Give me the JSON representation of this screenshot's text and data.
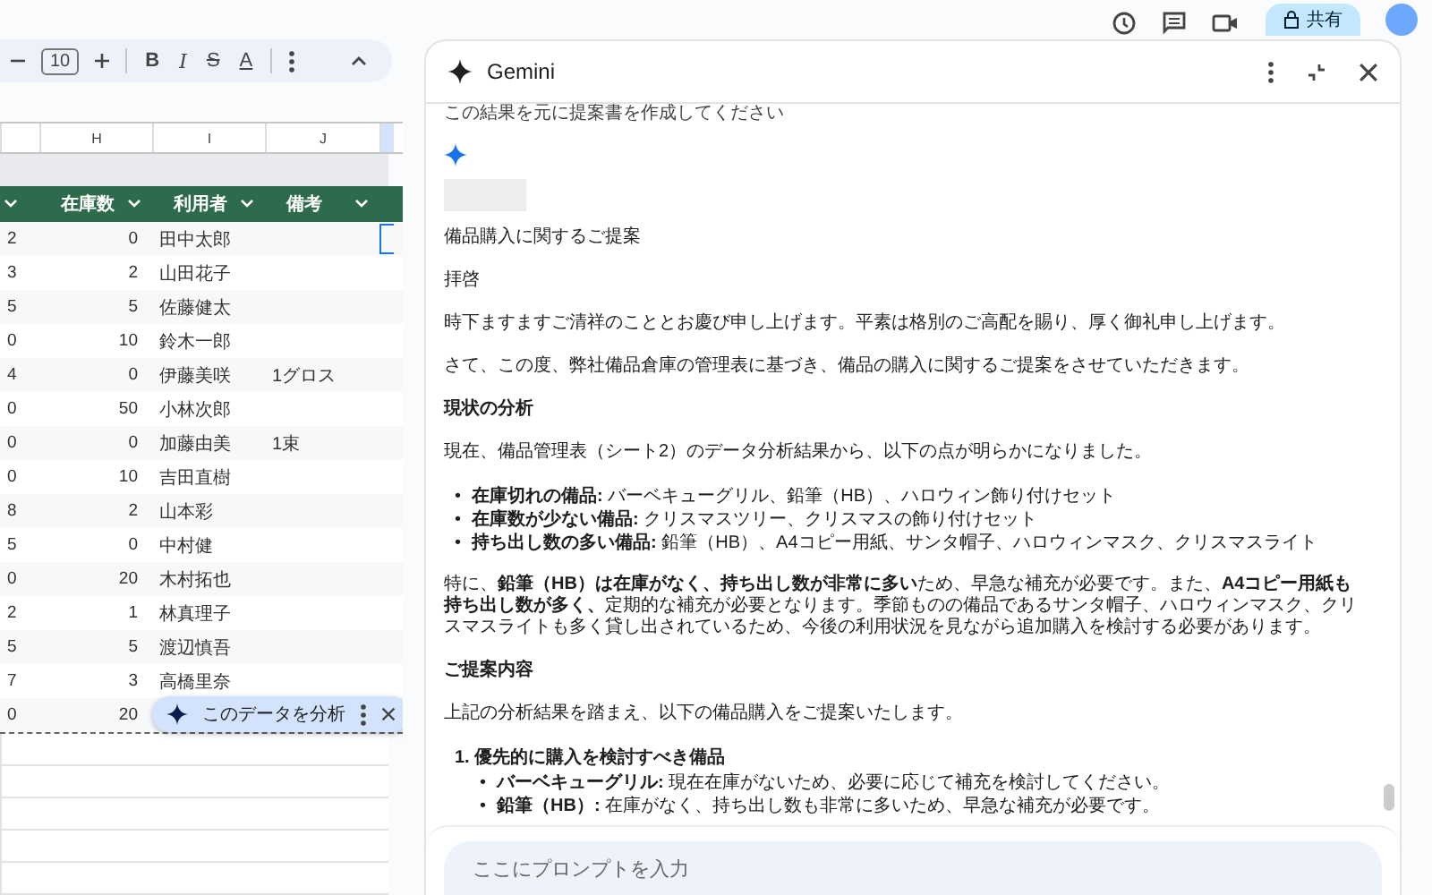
{
  "top_bar": {
    "share_label": "共有"
  },
  "toolbar": {
    "font_size": "10",
    "format_buttons": [
      {
        "kind": "bold",
        "label": "B"
      },
      {
        "kind": "italic",
        "label": "I"
      },
      {
        "kind": "strikethrough",
        "label": "S"
      },
      {
        "kind": "text_color",
        "label": "A"
      }
    ]
  },
  "sheet": {
    "column_letters": [
      "H",
      "I",
      "J"
    ],
    "headers": [
      "在庫数",
      "利用者",
      "備考"
    ],
    "rows": [
      {
        "column_1": "2",
        "stock": "0",
        "user": "田中太郎"
      },
      {
        "column_1": "3",
        "stock": "2",
        "user": "山田花子"
      },
      {
        "column_1": "5",
        "stock": "5",
        "user": "佐藤健太"
      },
      {
        "column_1": "0",
        "stock": "10",
        "user": "鈴木一郎"
      },
      {
        "column_1": "4",
        "stock": "0",
        "user": "伊藤美咲",
        "note": "1グロス"
      },
      {
        "column_1": "0",
        "stock": "50",
        "user": "小林次郎"
      },
      {
        "column_1": "0",
        "stock": "0",
        "user": "加藤由美",
        "note": "1束"
      },
      {
        "column_1": "0",
        "stock": "10",
        "user": "吉田直樹"
      },
      {
        "column_1": "8",
        "stock": "2",
        "user": "山本彩"
      },
      {
        "column_1": "5",
        "stock": "0",
        "user": "中村健"
      },
      {
        "column_1": "0",
        "stock": "20",
        "user": "木村拓也"
      },
      {
        "column_1": "2",
        "stock": "1",
        "user": "林真理子"
      },
      {
        "column_1": "5",
        "stock": "5",
        "user": "渡辺慎吾"
      },
      {
        "column_1": "7",
        "stock": "3",
        "user": "高橋里奈"
      },
      {
        "column_1": "0",
        "stock": "20"
      }
    ],
    "analyze_chip": {
      "label": "このデータを分析"
    }
  },
  "gemini": {
    "title": "Gemini",
    "user_prompt": "この結果を元に提案書を作成してください",
    "response": [
      {
        "kind": "paragraph",
        "text": "備品購入に関するご提案"
      },
      {
        "kind": "paragraph",
        "text": "拝啓"
      },
      {
        "kind": "paragraph",
        "text": "時下ますますご清祥のこととお慶び申し上げます。平素は格別のご高配を賜り、厚く御礼申し上げます。"
      },
      {
        "kind": "paragraph",
        "text": "さて、この度、弊社備品倉庫の管理表に基づき、備品の購入に関するご提案をさせていただきます。"
      },
      {
        "kind": "heading",
        "text": "現状の分析"
      },
      {
        "kind": "paragraph",
        "text": "現在、備品管理表（シート2）のデータ分析結果から、以下の点が明らかになりました。"
      },
      {
        "kind": "bullets",
        "marker": "•",
        "items": [
          "**在庫切れの備品:** バーベキューグリル、鉛筆（HB）、ハロウィン飾り付けセット",
          "**在庫数が少ない備品:** クリスマスツリー、クリスマスの飾り付けセット",
          "**持ち出し数の多い備品:** 鉛筆（HB）、A4コピー用紙、サンタ帽子、ハロウィンマスク、クリスマスライト"
        ]
      },
      {
        "kind": "paragraph",
        "text": "特に、**鉛筆（HB）は在庫がなく、持ち出し数が非常に多い**ため、早急な補充が必要です。また、**A4コピー用紙も持ち出し数が多く、**定期的な補充が必要となります。季節ものの備品であるサンタ帽子、ハロウィンマスク、クリスマスライトも多く貸し出されているため、今後の利用状況を見ながら追加購入を検討する必要があります。"
      },
      {
        "kind": "heading",
        "text": "ご提案内容"
      },
      {
        "kind": "paragraph",
        "text": "上記の分析結果を踏まえ、以下の備品購入をご提案いたします。"
      },
      {
        "kind": "numbered",
        "items": [
          {
            "number": "1.",
            "text": "優先的に購入を検討すべき備品",
            "marker": "•",
            "children": [
              "**バーベキューグリル:** 現在在庫がないため、必要に応じて補充を検討してください。",
              "**鉛筆（HB）:** 在庫がなく、持ち出し数も非常に多いため、早急な補充が必要です。"
            ]
          }
        ]
      }
    ],
    "input": {
      "placeholder": "ここにプロンプトを入力"
    }
  }
}
